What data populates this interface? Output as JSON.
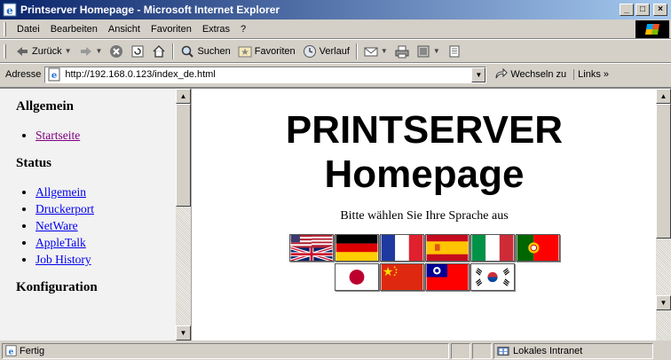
{
  "window": {
    "title": "Printserver Homepage - Microsoft Internet Explorer",
    "buttons": {
      "minimize": "_",
      "maximize": "□",
      "close": "×"
    }
  },
  "menu": [
    "Datei",
    "Bearbeiten",
    "Ansicht",
    "Favoriten",
    "Extras",
    "?"
  ],
  "toolbar": {
    "back": "Zurück",
    "search": "Suchen",
    "favorites": "Favoriten",
    "history": "Verlauf"
  },
  "address": {
    "label": "Adresse",
    "url": "http://192.168.0.123/index_de.html",
    "go": "Wechseln zu",
    "links": "Links"
  },
  "nav": {
    "general_heading": "Allgemein",
    "general_items": [
      "Startseite"
    ],
    "status_heading": "Status",
    "status_items": [
      "Allgemein",
      "Druckerport",
      "NetWare",
      "AppleTalk",
      "Job History"
    ],
    "config_heading": "Konfiguration"
  },
  "main": {
    "title_line1": "PRINTSERVER",
    "title_line2": "Homepage",
    "subtitle": "Bitte wählen Sie Ihre Sprache aus",
    "flags_row1": [
      "english",
      "german",
      "french",
      "spanish",
      "italian",
      "portuguese"
    ],
    "flags_row2": [
      "japanese",
      "chinese",
      "taiwanese",
      "korean"
    ]
  },
  "status": {
    "text": "Fertig",
    "zone": "Lokales Intranet"
  }
}
